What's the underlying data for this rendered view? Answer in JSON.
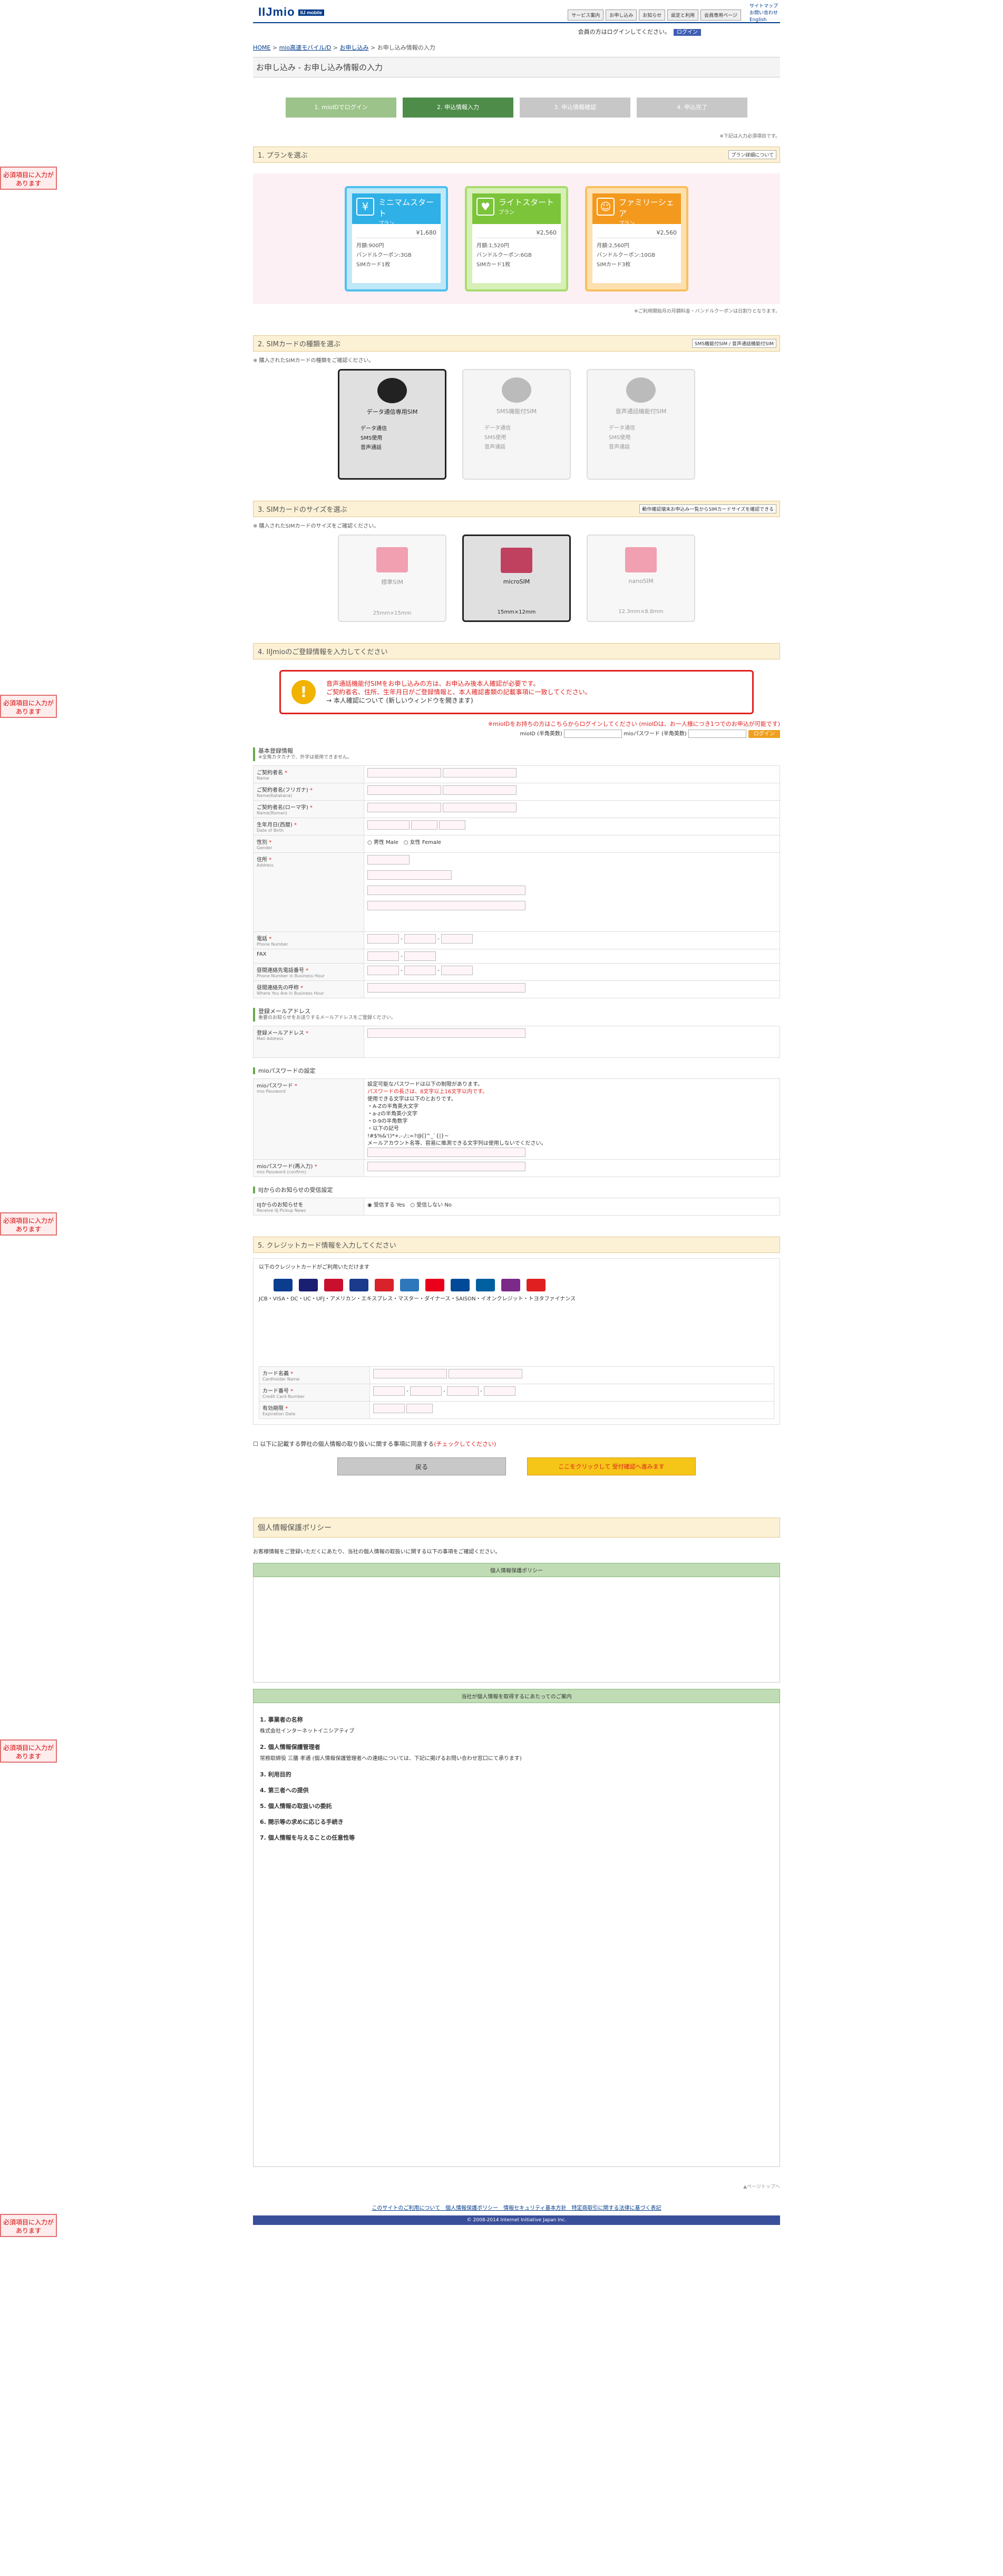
{
  "header": {
    "logo": "IIJmio",
    "logo_sub": "IIJ mobile",
    "nav": [
      "サービス案内",
      "お申し込み",
      "お知らせ",
      "設定と利用",
      "会員専用ページ"
    ],
    "side_links": [
      "サイトマップ",
      "お問い合わせ",
      "English"
    ],
    "login_text": "会員の方はログインしてください。",
    "login_btn": "ログイン",
    "id_link": "mioIDをお忘れの方"
  },
  "breadcrumb": [
    "HOME",
    "mio高速モバイル/D",
    "お申し込み",
    "お申し込み情報の入力"
  ],
  "page_title": "お申し込み - お申し込み情報の入力",
  "steps": [
    "1. mioIDでログイン",
    "2. 申込情報入力",
    "3. 申込情報確認",
    "4. 申込完了"
  ],
  "req_note": "※下記は入力必須項目です。",
  "sections": {
    "plan": "1. プランを選ぶ",
    "sim": "2. SIMカードの種類を選ぶ",
    "size": "3. SIMカードのサイズを選ぶ",
    "info": "4. IIJmioのご登録情報を入力してください",
    "card": "5. クレジットカード情報を入力してください"
  },
  "plan_detail": "プラン詳細について",
  "plans": [
    {
      "name": "ミニマムスタート",
      "sub": "プラン",
      "price": "¥1,680",
      "l1": "月額:900円",
      "l2": "バンドルクーポン:3GB",
      "l3": "SIMカード1枚"
    },
    {
      "name": "ライトスタート",
      "sub": "プラン",
      "price": "¥2,560",
      "l1": "月額:1,520円",
      "l2": "バンドルクーポン:6GB",
      "l3": "SIMカード1枚"
    },
    {
      "name": "ファミリーシェア",
      "sub": "プラン",
      "price": "¥2,560",
      "l1": "月額:2,560円",
      "l2": "バンドルクーポン:10GB",
      "l3": "SIMカード3枚"
    }
  ],
  "plan_note": "※ご利用開始月の月額料金・バンドルクーポンは日割りとなります。",
  "sim_note": "※ 購入されたSIMカードの種類をご確認ください。",
  "sim_tags": [
    "SMS機能付SIM",
    "音声通話機能付SIM"
  ],
  "sims": [
    {
      "name": "データ通信専用SIM",
      "items": [
        "データ通信",
        "SMS使用",
        "音声通話"
      ]
    },
    {
      "name": "SMS機能付SIM",
      "items": [
        "データ通信",
        "SMS使用",
        "音声通話"
      ]
    },
    {
      "name": "音声通話機能付SIM",
      "items": [
        "データ通信",
        "SMS使用",
        "音声通話"
      ]
    }
  ],
  "size_tag": "動作確認端末お申込み一覧からSIMカードサイズを確認できる",
  "size_note": "※ 購入されたSIMカードのサイズをご確認ください。",
  "sizes": [
    {
      "name": "標準SIM",
      "dim": "25mm×15mm"
    },
    {
      "name": "microSIM",
      "dim": "15mm×12mm"
    },
    {
      "name": "nanoSIM",
      "dim": "12.3mm×8.8mm"
    }
  ],
  "warn": {
    "l1": "音声通話機能付SIMをお申し込みの方は、お申込み後本人確認が必要です。",
    "l2": "ご契約者名、住所、生年月日がご登録情報と、本人確認書類の記載事項に一致してください。",
    "l3": "→ 本人確認について (新しいウィンドウを開きます)"
  },
  "login_line": "※mioIDをお持ちの方はこちらからログインしてください (mioIDは、お一人様につき1つでのお申込が可能です)",
  "login_row": {
    "id": "mioID (半角英数)",
    "pw": "mioパスワード (半角英数)",
    "btn": "ログイン"
  },
  "basic": {
    "title": "基本登録情報",
    "sub": "※全角カタカナで、外字は使用できません。"
  },
  "form": [
    {
      "label": "ご契約者名",
      "en": "Name"
    },
    {
      "label": "ご契約者名(フリガナ)",
      "en": "Name(Katakana)"
    },
    {
      "label": "ご契約者名(ローマ字)",
      "en": "Name(Roman)"
    },
    {
      "label": "生年月日(西暦)",
      "en": "Date of Birth"
    },
    {
      "label": "性別",
      "en": "Gender"
    },
    {
      "label": "住所",
      "en": "Address"
    },
    {
      "label": "電話",
      "en": "Phone Number"
    },
    {
      "label": "FAX",
      "en": ""
    },
    {
      "label": "昼間連絡先電話番号",
      "en": "Phone Number in Business Hour"
    },
    {
      "label": "昼間連絡先の呼称",
      "en": "Where You Are in Business Hour"
    }
  ],
  "gender": [
    "男性 Male",
    "女性 Female"
  ],
  "mail": {
    "title": "登録メールアドレス",
    "sub": "重要のお知らせをお送りするメールアドレスをご登録ください。",
    "label": "登録メールアドレス",
    "en": "Mail Address"
  },
  "pw": {
    "title": "mioパスワードの設定",
    "label": "mioパスワード",
    "en": "mio Password",
    "label2": "mioパスワード(再入力)",
    "en2": "mio Password (confirm)",
    "rules": [
      "設定可能なパスワードは以下の制限があります。",
      "パスワードの長さは、8文字以上16文字以内です。",
      "使用できる文字は以下のとおりです。",
      "・A-Zの半角英大文字",
      "・a-zの半角英小文字",
      "・0-9の半角数字",
      "・以下の記号",
      "!#$%&'()*+,-./:;=?@[]^_`{|}~",
      "メールアカウント名等、容易に推測できる文字列は使用しないでください。"
    ]
  },
  "news": {
    "title": "IIJからのお知らせの受信設定",
    "label": "IIJからのお知らせを",
    "en": "Receive IIJ Pickup News",
    "opts": [
      "受信する Yes",
      "受信しない No"
    ]
  },
  "cc": {
    "intro": "以下のクレジットカードがご利用いただけます",
    "brands": "JCB・VISA・DC・UC・UFJ・アメリカン・エキスプレス・マスター・ダイナース・SAISON・イオンクレジット・トヨタファイナンス",
    "label1": "カード名義",
    "en1": "Cardholder Name",
    "label2": "カード番号",
    "en2": "Credit Card Number",
    "label3": "有効期限",
    "en3": "Expiration Date"
  },
  "agree": "以下に記載する弊社の個人情報の取り扱いに関する事項に同意する",
  "agree_note": "(チェックしてください)",
  "back_btn": "戻る",
  "next_btn": "ここをクリックして 受付確認へ進みます",
  "privacy": {
    "title": "個人情報保護ポリシー",
    "intro": "お客様情報をご登録いただくにあたり、当社の個人情報の取扱いに関する以下の事項をご確認ください。",
    "policy_head": "個人情報保護ポリシー",
    "second_head": "当社が個人情報を取得するにあたってのご案内"
  },
  "privacy_body": [
    "1. 事業者の名称",
    "株式会社インターネットイニシアティブ",
    "2. 個人情報保護管理者",
    "常務取締役 三膳 孝通 (個人情報保護管理者への連絡については、下記に掲げるお問い合わせ窓口にて承ります)",
    "3. 利用目的",
    "4. 第三者への提供",
    "5. 個人情報の取扱いの委託",
    "6. 開示等の求めに応じる手続き",
    "7. 個人情報を与えることの任意性等"
  ],
  "footer": {
    "links": "このサイトのご利用について　個人情報保護ポリシー　情報セキュリティ基本方針　特定商取引に関する法律に基づく表記",
    "copy": "© 2008-2014 Internet Initiative Japan Inc.",
    "pagetop": "▲ページトップへ"
  },
  "badges": [
    "必須項目に入力があります",
    "必須項目に入力があります",
    "必須項目に入力があります",
    "必須項目に入力があります",
    "必須項目に入力があります"
  ]
}
